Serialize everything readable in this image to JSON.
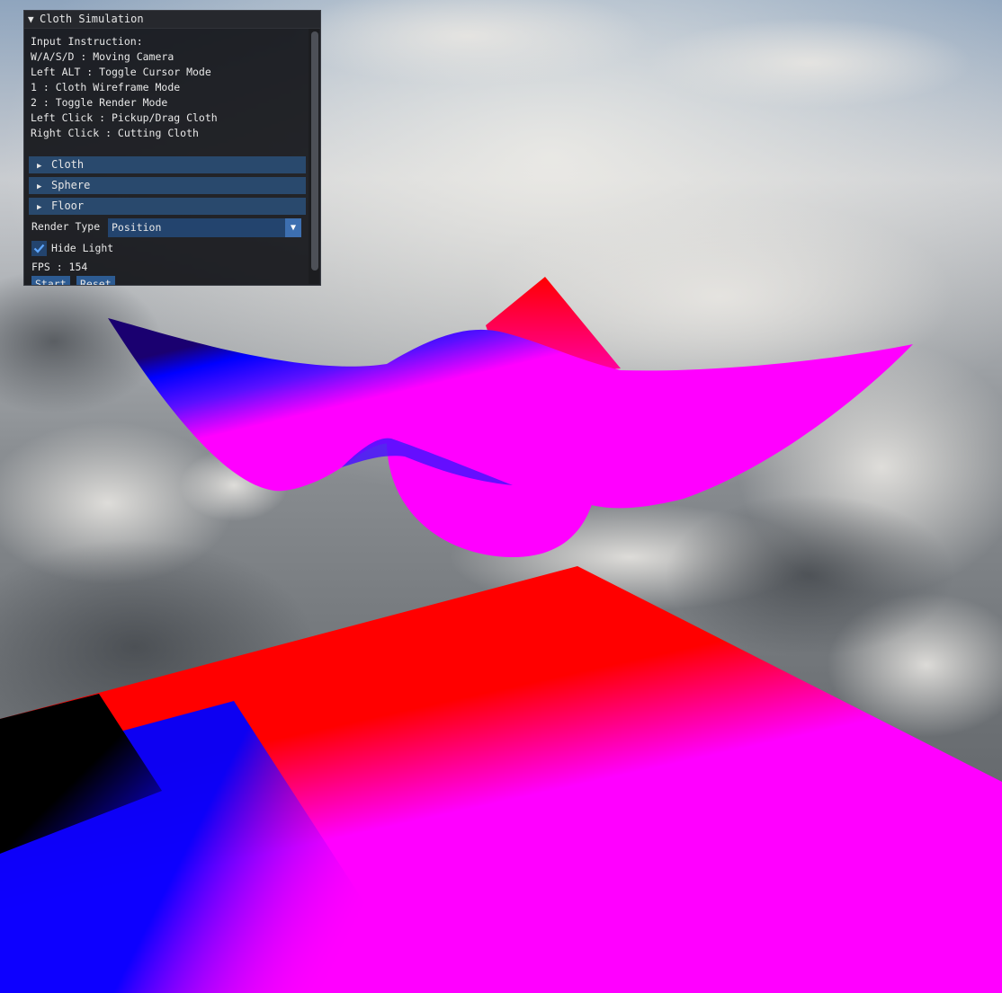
{
  "window": {
    "title": "Cloth Simulation"
  },
  "instructions": [
    "Input Instruction:",
    "W/A/S/D : Moving Camera",
    "Left ALT : Toggle Cursor Mode",
    "1 : Cloth Wireframe Mode",
    "2 : Toggle Render Mode",
    "Left Click : Pickup/Drag Cloth",
    "Right Click : Cutting Cloth"
  ],
  "sections": [
    {
      "label": "Cloth",
      "expanded": false
    },
    {
      "label": "Sphere",
      "expanded": false
    },
    {
      "label": "Floor",
      "expanded": false
    }
  ],
  "render_type": {
    "label": "Render Type",
    "value": "Position"
  },
  "hide_light": {
    "label": "Hide Light",
    "checked": true
  },
  "fps": {
    "text": "FPS : 154"
  },
  "buttons": {
    "start": "Start",
    "reset": "Reset"
  },
  "colors": {
    "panel_bg": "#0e1014",
    "header_bg": "#29496d",
    "cloth": "#ff00ff",
    "floor_red": "#ff0000",
    "floor_blue": "#0000ff",
    "floor_black": "#000000"
  }
}
